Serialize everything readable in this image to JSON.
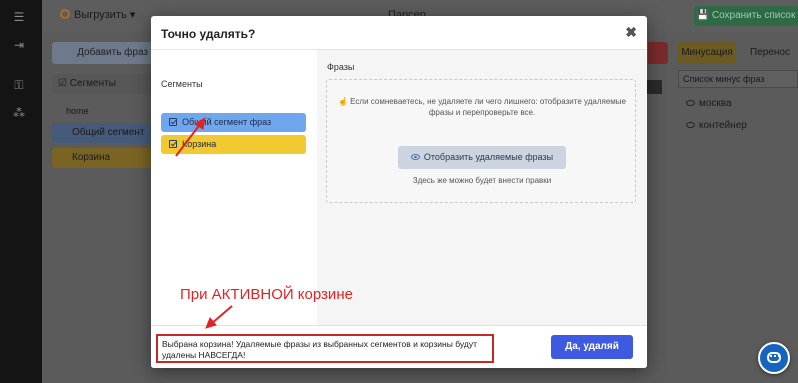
{
  "background": {
    "topbar": {
      "export_label": "Выгрузить",
      "title": "Парсер",
      "save_label": "Сохранить список"
    },
    "add_phrase_label": "Добавить фраз",
    "segments_header": "Сегменты",
    "home_label": "home",
    "common_segment_label": "Общий сегмент фраз",
    "basket_label": "Корзина",
    "tabs": [
      "Минусация",
      "Перенос"
    ],
    "minus_list_select": "Список минус фраз",
    "minus_items": [
      "москва",
      "контейнер"
    ]
  },
  "modal": {
    "title": "Точно удалять?",
    "close_glyph": "✖",
    "segments_label": "Сегменты",
    "segments": [
      {
        "label": "Общий сегмент фраз",
        "color": "#6fa7ef"
      },
      {
        "label": "Корзина",
        "color": "#f1c930"
      }
    ],
    "phrases_label": "Фразы",
    "hint": "☝ Если сомневаетесь, не удаляете ли чего лишнего: отобразите удаляемые фразы и перепроверьте все.",
    "show_button_label": "Отобразить удаляемые фразы",
    "sub_hint": "Здесь же можно будет внести правки",
    "warning_text": "Выбрана корзина! Удаляемые фразы из выбранных сегментов и корзины будут удалены НАВСЕГДА!",
    "confirm_label": "Да, удаляй"
  },
  "annotation": {
    "text": "При АКТИВНОЙ корзине",
    "color": "#e02424"
  },
  "colors": {
    "accent": "#3e5ae0",
    "warning_border": "#c62828",
    "save_green": "#2f6a46"
  }
}
